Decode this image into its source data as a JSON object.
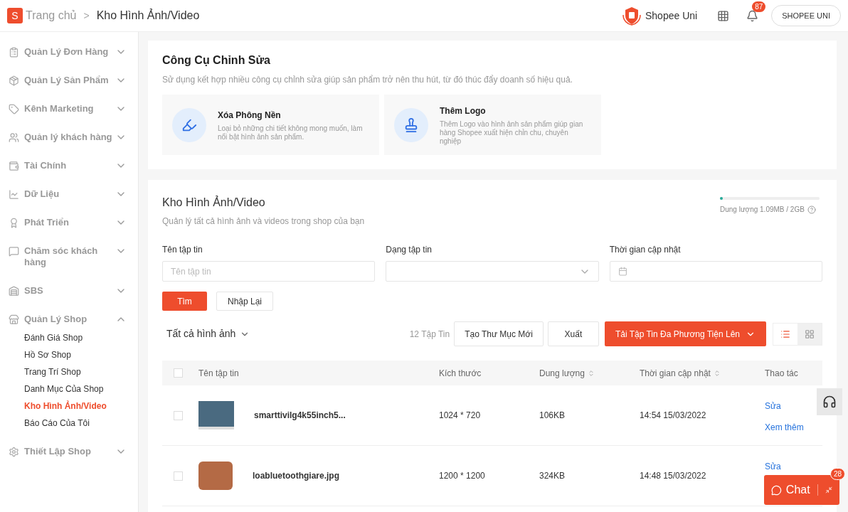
{
  "header": {
    "logo": "S",
    "breadcrumb": [
      {
        "label": "Trang chủ"
      },
      {
        "label": "Kho Hình Ảnh/Video"
      }
    ],
    "separator": ">",
    "uni_label": "Shopee Uni",
    "notification_count": "87",
    "account_button": "SHOPEE UNI"
  },
  "sidebar": {
    "items": [
      {
        "label": "Quản Lý Đơn Hàng",
        "expanded": false
      },
      {
        "label": "Quản Lý Sản Phẩm",
        "expanded": false
      },
      {
        "label": "Kênh Marketing",
        "expanded": false
      },
      {
        "label": "Quản lý khách hàng",
        "expanded": false
      },
      {
        "label": "Tài Chính",
        "expanded": false
      },
      {
        "label": "Dữ Liệu",
        "expanded": false
      },
      {
        "label": "Phát Triển",
        "expanded": false
      },
      {
        "label": "Chăm sóc khách hàng",
        "expanded": false
      },
      {
        "label": "SBS",
        "expanded": false
      },
      {
        "label": "Quản Lý Shop",
        "expanded": true,
        "children": [
          {
            "label": "Đánh Giá Shop",
            "selected": false
          },
          {
            "label": "Hồ Sơ Shop",
            "selected": false
          },
          {
            "label": "Trang Trí Shop",
            "selected": false
          },
          {
            "label": "Danh Mục Của Shop",
            "selected": false
          },
          {
            "label": "Kho Hình Ảnh/Video",
            "selected": true
          },
          {
            "label": "Báo Cáo Của Tôi",
            "selected": false
          }
        ]
      },
      {
        "label": "Thiết Lập Shop",
        "expanded": false
      }
    ]
  },
  "tools_card": {
    "title": "Công Cụ Chỉnh Sửa",
    "subtitle": "Sử dụng kết hợp nhiều công cụ chỉnh sửa giúp sản phẩm trở nên thu hút, từ đó thúc đẩy doanh số hiệu quả.",
    "tools": [
      {
        "kind": "eraser",
        "title": "Xóa Phông Nền",
        "description": "Loại bỏ những chi tiết không mong muốn, làm nổi bật hình ảnh sản phẩm."
      },
      {
        "kind": "logo",
        "title": "Thêm Logo",
        "description": "Thêm Logo vào hình ảnh sản phẩm giúp gian hàng Shopee xuất hiện chỉn chu, chuyên nghiệp"
      }
    ]
  },
  "library": {
    "title": "Kho Hình Ảnh/Video",
    "subtitle": "Quản lý tất cả hình ảnh và videos trong shop của bạn",
    "storage": {
      "level": 0.01,
      "label": "Dung lượng 1.09MB / 2GB"
    },
    "filters": [
      {
        "kind": "text",
        "label": "Tên tập tin",
        "placeholder": "Tên tập tin"
      },
      {
        "kind": "select",
        "label": "Dạng tập tin"
      },
      {
        "kind": "date",
        "label": "Thời gian cập nhật"
      }
    ],
    "search_button": "Tìm",
    "reset_button": "Nhập Lại",
    "folder_select": "Tất cả hình ảnh",
    "file_count": "12 Tập Tin",
    "new_folder_button": "Tạo Thư Mục Mới",
    "export_button": "Xuất",
    "upload_button": "Tải Tập Tin Đa Phương Tiện Lên",
    "views": [
      {
        "kind": "list",
        "selected": true
      },
      {
        "kind": "grid",
        "selected": false
      }
    ],
    "table": {
      "select_all_checked": false,
      "columns": [
        {
          "label": "Tên tập tin",
          "sortable": false
        },
        {
          "label": "Kích thước",
          "sortable": false
        },
        {
          "label": "Dung lượng",
          "sortable": true
        },
        {
          "label": "Thời gian cập nhật",
          "sortable": true
        },
        {
          "label": "Thao tác",
          "sortable": false
        }
      ],
      "rows": [
        {
          "checked": false,
          "name": "smarttivilg4k55inch5...",
          "dimensions": "1024 * 720",
          "size": "106KB",
          "updated": "14:54 15/03/2022",
          "actions": [
            "Sửa",
            "Xem thêm"
          ]
        },
        {
          "checked": false,
          "name": "loabluetoothgiare.jpg",
          "dimensions": "1200 * 1200",
          "size": "324KB",
          "updated": "14:48 15/03/2022",
          "actions": [
            "Sửa"
          ]
        }
      ]
    }
  },
  "chat": {
    "label": "Chat",
    "badge": "28"
  }
}
